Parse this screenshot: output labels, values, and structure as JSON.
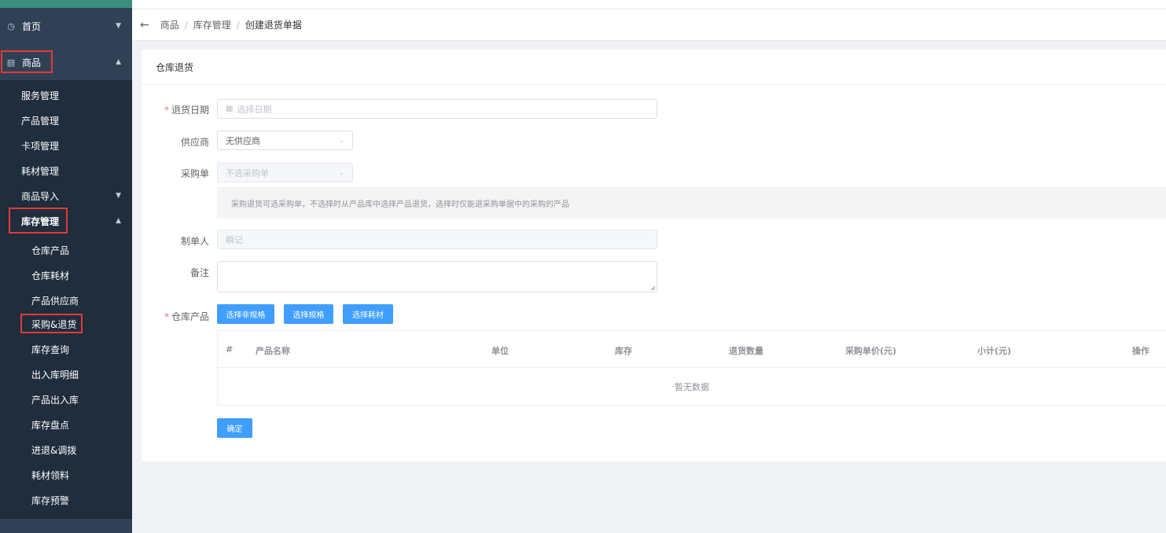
{
  "sidebar": {
    "items": [
      {
        "label": "首页",
        "icon": "dashboard-icon"
      },
      {
        "label": "商品",
        "icon": "document-icon"
      }
    ],
    "goods_sub": [
      "服务管理",
      "产品管理",
      "卡项管理",
      "耗材管理",
      "商品导入",
      "库存管理"
    ],
    "stock_sub": [
      "仓库产品",
      "仓库耗材",
      "产品供应商",
      "采购&退货",
      "库存查询",
      "出入库明细",
      "产品出入库",
      "库存盘点",
      "进退&调拨",
      "耗材领料",
      "库存预警"
    ]
  },
  "breadcrumb": {
    "back_icon": "←",
    "items": [
      "商品",
      "库存管理",
      "创建退货单据"
    ],
    "sep": "/"
  },
  "card": {
    "title": "仓库退货"
  },
  "form": {
    "return_date": {
      "label": "退货日期",
      "placeholder": "选择日期",
      "icon": "calendar-icon"
    },
    "supplier": {
      "label": "供应商",
      "value": "无供应商"
    },
    "purchase_order": {
      "label": "采购单",
      "placeholder": "不选采购单"
    },
    "tip": "采购退货可选采购单，不选择时从产品库中选择产品退货，选择时仅能退采购单据中的采购的产品",
    "creator": {
      "label": "制单人",
      "value": "瞬记"
    },
    "remark": {
      "label": "备注"
    },
    "products": {
      "label": "仓库产品"
    },
    "buttons": {
      "non_spec": "选择非规格",
      "spec": "选择规格",
      "consumable": "选择耗材",
      "confirm": "确定"
    }
  },
  "table": {
    "columns": [
      "#",
      "产品名称",
      "单位",
      "库存",
      "退货数量",
      "采购单价(元)",
      "小计(元)",
      "操作"
    ],
    "empty_text": "暂无数据"
  },
  "colors": {
    "primary": "#409eff",
    "sidebar": "#1f2d3d",
    "highlight": "#e53935"
  }
}
